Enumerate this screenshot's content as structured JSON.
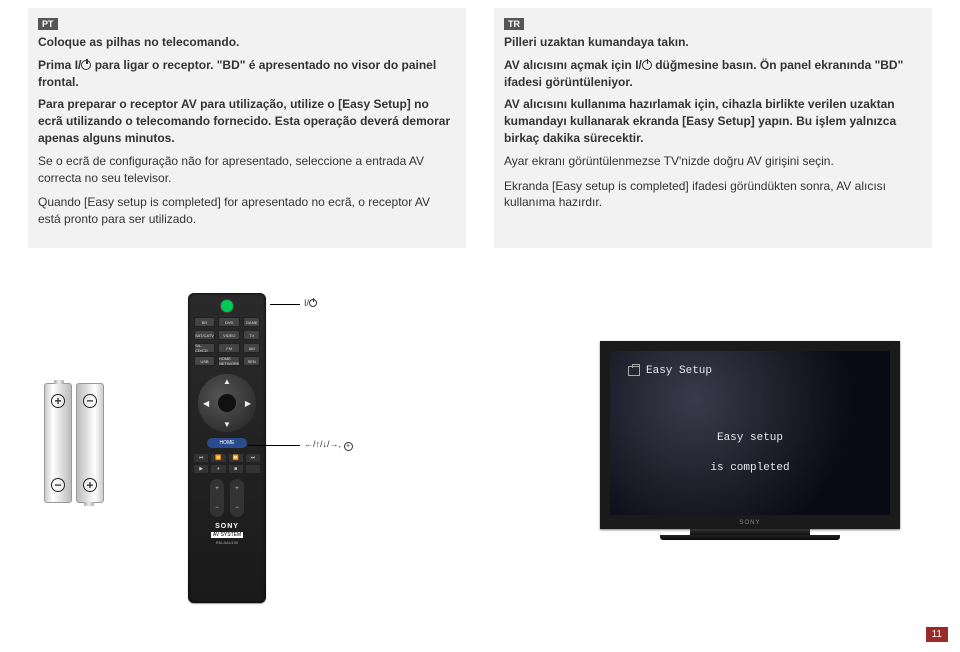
{
  "page_number": "11",
  "langs": {
    "pt": "PT",
    "tr": "TR"
  },
  "pt": {
    "h1": "Coloque as pilhas no telecomando.",
    "p1_a": "Prima ",
    "p1_power": "⏻",
    "p1_b": " para ligar o receptor. \"BD\" é apresentado no visor do painel frontal.",
    "p2": "Para preparar o receptor AV para utilização, utilize o [Easy Setup] no ecrã utilizando o telecomando fornecido. Esta operação deverá demorar apenas alguns minutos.",
    "p3": "Se o ecrã de configuração não for apresentado, seleccione a entrada AV correcta no seu televisor.",
    "p4": "Quando [Easy setup is completed] for apresentado no ecrã, o receptor AV está pronto para ser utilizado."
  },
  "tr": {
    "h1": "Pilleri uzaktan kumandaya takın.",
    "p1_a": "AV alıcısını açmak için ",
    "p1_b": " düğmesine basın. Ön panel ekranında \"BD\" ifadesi görüntüleniyor.",
    "p2": "AV alıcısını kullanıma hazırlamak için, cihazla birlikte verilen uzaktan kumandayı kullanarak ekranda [Easy Setup] yapın. Bu işlem yalnızca birkaç dakika sürecektir.",
    "p3": "Ayar ekranı görüntülenmezse TV'nizde doğru AV girişini seçin.",
    "p4": "Ekranda [Easy setup is completed] ifadesi göründükten sonra, AV alıcısı kullanıma hazırdır."
  },
  "remote": {
    "row1": [
      "BD",
      "DVD",
      "GAME"
    ],
    "row2": [
      "SAT/CATV",
      "VIDEO",
      "TV"
    ],
    "row3": [
      "SA-CD/CD",
      "FM",
      "AM"
    ],
    "row4": [
      "USB",
      "HOME NETWORK",
      "SEN"
    ],
    "home": "HOME",
    "sony": "SONY",
    "av": "AV SYSTEM",
    "model": "RM-AAU190"
  },
  "labels": {
    "power_line": "⏻",
    "nav_line": "←/↑/↓/→, ⊕"
  },
  "tv": {
    "title": "Easy Setup",
    "line1": "Easy setup",
    "line2": "is completed",
    "brand": "SONY"
  },
  "batteries": {
    "plus": "+",
    "minus": "−"
  }
}
